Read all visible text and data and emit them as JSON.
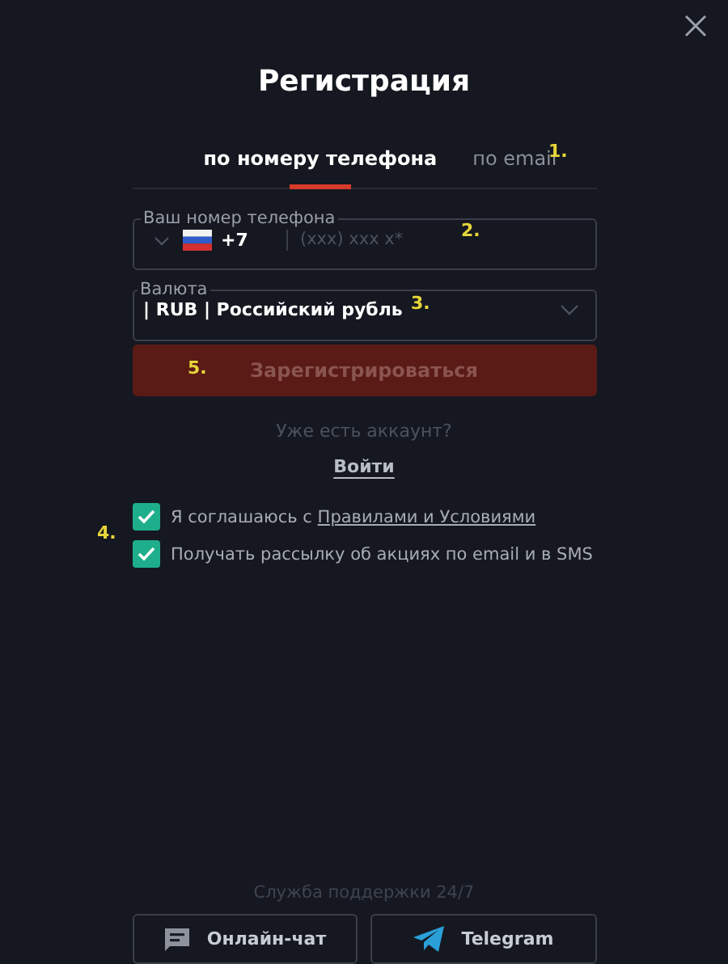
{
  "title": "Регистрация",
  "tabs": [
    {
      "label": "по номеру телефона",
      "selected": true
    },
    {
      "label": "по email",
      "selected": false
    }
  ],
  "phone": {
    "label": "Ваш номер телефона",
    "code": "+7",
    "placeholder": "(xxx) xxx x*"
  },
  "currency": {
    "label": "Валюта",
    "value": "| RUB | Российский рубль"
  },
  "submit": {
    "label": "Зарегистрироваться",
    "disabled": true
  },
  "login_prompt": "Уже есть аккаунт?",
  "login_link": "Войти",
  "consents": [
    {
      "text": "Я соглашаюсь с ",
      "link": "Правилами и Условиями",
      "checked": true
    },
    {
      "text": "Получать рассылку об акциях по email и в SMS",
      "checked": true
    }
  ],
  "support": {
    "label": "Служба поддержки 24/7",
    "buttons": [
      {
        "kind": "chat",
        "label": "Онлайн-чат"
      },
      {
        "kind": "telegram",
        "label": "Telegram"
      }
    ]
  },
  "annotations": [
    "1.",
    "2.",
    "3.",
    "4.",
    "5."
  ]
}
